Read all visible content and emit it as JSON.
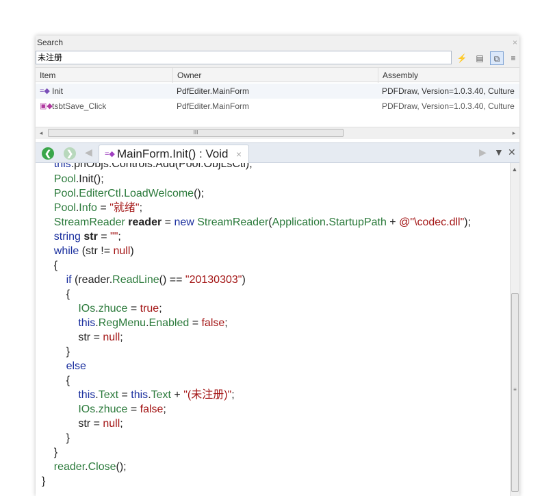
{
  "search_panel": {
    "title": "Search",
    "close_glyph": "×",
    "query": "未注册",
    "toolbar": [
      {
        "icon": "search-scope-icon",
        "glyph": "⚡"
      },
      {
        "icon": "properties-icon",
        "glyph": "▤"
      },
      {
        "icon": "copy-icon",
        "glyph": "⧉"
      },
      {
        "icon": "menu-icon",
        "glyph": "≡"
      }
    ]
  },
  "results": {
    "columns": [
      "Item",
      "Owner",
      "Assembly"
    ],
    "rows": [
      {
        "item": "Init",
        "owner": "PdfEditer.MainForm",
        "assembly": "PDFDraw, Version=1.0.3.40, Culture"
      },
      {
        "item": "tsbtSave_Click",
        "owner": "PdfEditer.MainForm",
        "assembly": "PDFDraw, Version=1.0.3.40, Culture"
      }
    ],
    "scroll_grip": "III"
  },
  "editor": {
    "tab_title": "MainForm.Init() : Void",
    "tab_close_glyph": "×",
    "lines": [
      "    this.pnObjs.Controls.Add(Pool.ObjLsCtl);",
      "    Pool.Init();",
      "    Pool.EditerCtl.LoadWelcome();",
      "    Pool.Info = \"就绪\";",
      "    StreamReader reader = new StreamReader(Application.StartupPath + @\"\\codec.dll\");",
      "    string str = \"\";",
      "    while (str != null)",
      "    {",
      "        if (reader.ReadLine() == \"20130303\")",
      "        {",
      "            IOs.zhuce = true;",
      "            this.RegMenu.Enabled = false;",
      "            str = null;",
      "        }",
      "        else",
      "        {",
      "            this.Text = this.Text + \"(未注册)\";",
      "            IOs.zhuce = false;",
      "            str = null;",
      "        }",
      "    }",
      "    reader.Close();",
      "}"
    ]
  }
}
